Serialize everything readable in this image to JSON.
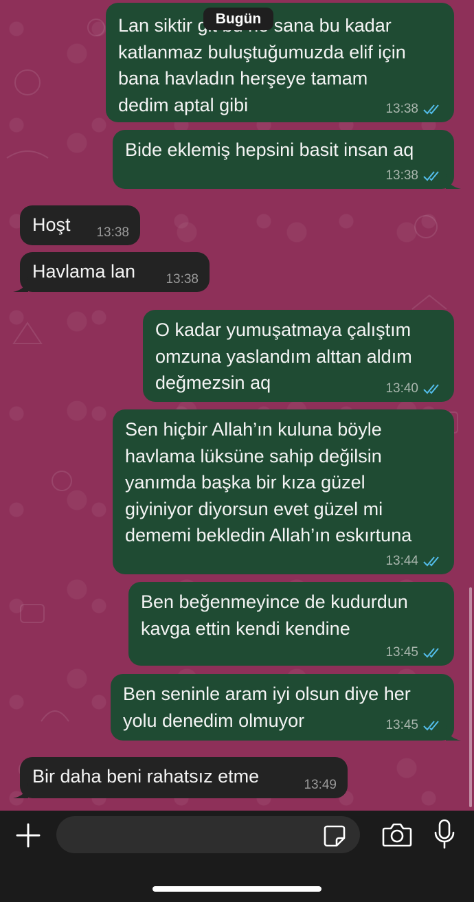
{
  "chat": {
    "date_chip": "Bugün",
    "messages": [
      {
        "dir": "out",
        "text": "Lan siktir git bu ne sana bu kadar\nkatlanmaz buluştuğumuzda elif için\nbana havladın  herşeye tamam\ndedim aptal gibi",
        "time": "13:38",
        "status": "read"
      },
      {
        "dir": "out",
        "text": "Bide eklemiş hepsini basit insan aq",
        "time": "13:38",
        "status": "read"
      },
      {
        "dir": "in",
        "text": "Hoşt",
        "time": "13:38"
      },
      {
        "dir": "in",
        "text": "Havlama lan",
        "time": "13:38"
      },
      {
        "dir": "out",
        "text": "O kadar yumuşatmaya çalıştım\nomzuna yaslandım alttan aldım\ndeğmezsin aq",
        "time": "13:40",
        "status": "read"
      },
      {
        "dir": "out",
        "text": "Sen hiçbir Allah’ın kuluna böyle\nhavlama lüksüne sahip değilsin\nyanımda başka bir kıza güzel\ngiyiniyor diyorsun evet güzel mi\ndememi bekledin Allah’ın eskırtuna",
        "time": "13:44",
        "status": "read"
      },
      {
        "dir": "out",
        "text": "Ben beğenmeyince de kudurdun\nkavga ettin kendi kendine",
        "time": "13:45",
        "status": "read"
      },
      {
        "dir": "out",
        "text": "Ben seninle aram iyi olsun diye her\nyolu denedim olmuyor",
        "time": "13:45",
        "status": "read"
      },
      {
        "dir": "in",
        "text": "Bir daha beni rahatsız etme",
        "time": "13:49"
      }
    ]
  },
  "composer": {
    "value": "",
    "placeholder": ""
  },
  "icons": {
    "attach": "plus-icon",
    "sticker": "sticker-icon",
    "camera": "camera-icon",
    "mic": "microphone-icon",
    "read_receipt": "double-check-icon"
  },
  "colors": {
    "wallpaper": "#8e3059",
    "outgoing_bubble": "#1f4b33",
    "incoming_bubble": "#232323",
    "read_ticks": "#53bdeb"
  }
}
